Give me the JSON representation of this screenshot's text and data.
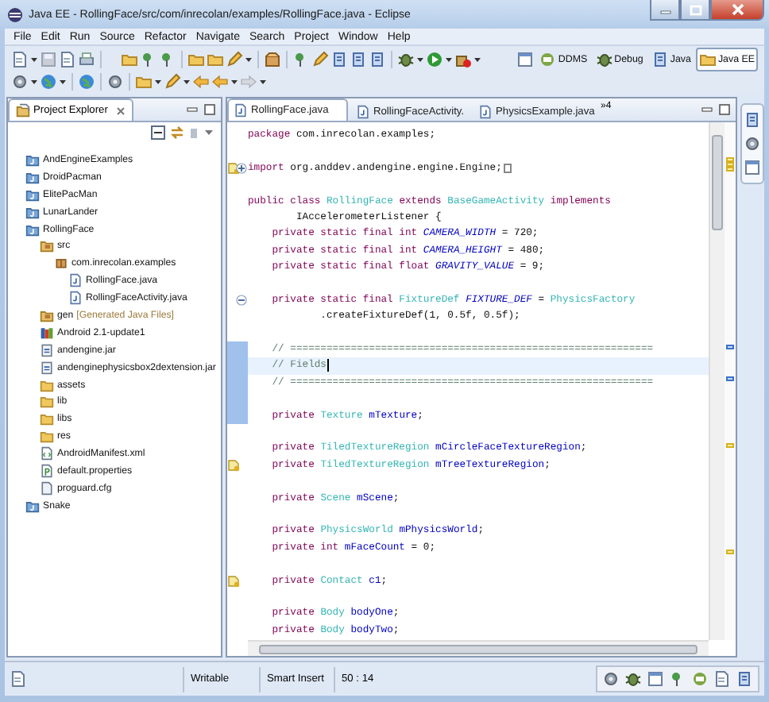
{
  "window": {
    "title": "Java EE - RollingFace/src/com/inrecolan/examples/RollingFace.java - Eclipse"
  },
  "menu": [
    "File",
    "Edit",
    "Run",
    "Source",
    "Refactor",
    "Navigate",
    "Search",
    "Project",
    "Window",
    "Help"
  ],
  "perspectives": [
    {
      "label": "DDMS",
      "kind": "ddms",
      "selected": false
    },
    {
      "label": "Debug",
      "kind": "debug",
      "selected": false
    },
    {
      "label": "Java",
      "kind": "java",
      "selected": false
    },
    {
      "label": "Java EE",
      "kind": "javaee",
      "selected": true
    }
  ],
  "explorer": {
    "title": "Project Explorer",
    "items": [
      {
        "label": "AndEngineExamples",
        "kind": "project"
      },
      {
        "label": "DroidPacman",
        "kind": "project"
      },
      {
        "label": "ElitePacMan",
        "kind": "project"
      },
      {
        "label": "LunarLander",
        "kind": "project"
      },
      {
        "label": "RollingFace",
        "kind": "project",
        "children": [
          {
            "label": "src",
            "kind": "source-folder",
            "children": [
              {
                "label": "com.inrecolan.examples",
                "kind": "package",
                "children": [
                  {
                    "label": "RollingFace.java",
                    "kind": "java"
                  },
                  {
                    "label": "RollingFaceActivity.java",
                    "kind": "java"
                  }
                ]
              }
            ]
          },
          {
            "label": "gen",
            "decoration": "[Generated Java Files]",
            "kind": "source-folder"
          },
          {
            "label": "Android 2.1-update1",
            "kind": "library"
          },
          {
            "label": "andengine.jar",
            "kind": "jar"
          },
          {
            "label": "andenginephysicsbox2dextension.jar",
            "kind": "jar"
          },
          {
            "label": "assets",
            "kind": "folder"
          },
          {
            "label": "lib",
            "kind": "folder"
          },
          {
            "label": "libs",
            "kind": "folder"
          },
          {
            "label": "res",
            "kind": "folder"
          },
          {
            "label": "AndroidManifest.xml",
            "kind": "xml"
          },
          {
            "label": "default.properties",
            "kind": "properties"
          },
          {
            "label": "proguard.cfg",
            "kind": "file"
          }
        ]
      },
      {
        "label": "Snake",
        "kind": "project"
      }
    ]
  },
  "editor": {
    "tabs": [
      {
        "label": "RollingFace.java",
        "selected": true
      },
      {
        "label": "RollingFaceActivity.",
        "selected": false
      },
      {
        "label": "PhysicsExample.java",
        "selected": false
      }
    ],
    "overflow": "»4",
    "lines": [
      {
        "kind": "code",
        "tokens": [
          {
            "kind": "keyword",
            "text": "package"
          },
          {
            "kind": "plain",
            "text": " com.inrecolan.examples;"
          }
        ]
      },
      {
        "kind": "blank"
      },
      {
        "kind": "code",
        "warning": true,
        "folded": true,
        "tokens": [
          {
            "kind": "keyword",
            "text": "import"
          },
          {
            "kind": "plain",
            "text": " org.anddev.andengine.engine.Engine;"
          }
        ]
      },
      {
        "kind": "blank"
      },
      {
        "kind": "code",
        "tokens": [
          {
            "kind": "keyword",
            "text": "public class "
          },
          {
            "kind": "type",
            "text": "RollingFace"
          },
          {
            "kind": "keyword",
            "text": " extends "
          },
          {
            "kind": "type",
            "text": "BaseGameActivity"
          },
          {
            "kind": "keyword",
            "text": " implements"
          }
        ]
      },
      {
        "kind": "code",
        "tokens": [
          {
            "kind": "plain",
            "text": "        IAccelerometerListener {"
          }
        ]
      },
      {
        "kind": "code",
        "tokens": [
          {
            "kind": "keyword",
            "text": "    private static final int "
          },
          {
            "kind": "constant",
            "text": "CAMERA_WIDTH"
          },
          {
            "kind": "plain",
            "text": " = 720;"
          }
        ]
      },
      {
        "kind": "code",
        "tokens": [
          {
            "kind": "keyword",
            "text": "    private static final int "
          },
          {
            "kind": "constant",
            "text": "CAMERA_HEIGHT"
          },
          {
            "kind": "plain",
            "text": " = 480;"
          }
        ]
      },
      {
        "kind": "code",
        "tokens": [
          {
            "kind": "keyword",
            "text": "    private static final float "
          },
          {
            "kind": "constant",
            "text": "GRAVITY_VALUE"
          },
          {
            "kind": "plain",
            "text": " = 9;"
          }
        ]
      },
      {
        "kind": "blank"
      },
      {
        "kind": "code",
        "folded": false,
        "tokens": [
          {
            "kind": "keyword",
            "text": "    private static final "
          },
          {
            "kind": "type",
            "text": "FixtureDef "
          },
          {
            "kind": "constant",
            "text": "FIXTURE_DEF"
          },
          {
            "kind": "plain",
            "text": " = "
          },
          {
            "kind": "type",
            "text": "PhysicsFactory"
          }
        ]
      },
      {
        "kind": "code",
        "tokens": [
          {
            "kind": "plain",
            "text": "            .createFixtureDef(1, 0.5f, 0.5f);"
          }
        ]
      },
      {
        "kind": "blank"
      },
      {
        "kind": "code",
        "range": true,
        "tokens": [
          {
            "kind": "comment",
            "text": "    // ============================================================"
          }
        ]
      },
      {
        "kind": "code",
        "range": true,
        "current": true,
        "tokens": [
          {
            "kind": "comment",
            "text": "    // Fields"
          }
        ]
      },
      {
        "kind": "code",
        "range": true,
        "tokens": [
          {
            "kind": "comment",
            "text": "    // ============================================================"
          }
        ]
      },
      {
        "kind": "blank",
        "range": true
      },
      {
        "kind": "code",
        "range": true,
        "tokens": [
          {
            "kind": "keyword",
            "text": "    private "
          },
          {
            "kind": "type",
            "text": "Texture "
          },
          {
            "kind": "field",
            "text": "mTexture"
          },
          {
            "kind": "plain",
            "text": ";"
          }
        ]
      },
      {
        "kind": "blank"
      },
      {
        "kind": "code",
        "tokens": [
          {
            "kind": "keyword",
            "text": "    private "
          },
          {
            "kind": "type",
            "text": "TiledTextureRegion "
          },
          {
            "kind": "field",
            "text": "mCircleFaceTextureRegion"
          },
          {
            "kind": "plain",
            "text": ";"
          }
        ]
      },
      {
        "kind": "code",
        "warning": true,
        "tokens": [
          {
            "kind": "keyword",
            "text": "    private "
          },
          {
            "kind": "type",
            "text": "TiledTextureRegion "
          },
          {
            "kind": "field",
            "text": "mTreeTextureRegion"
          },
          {
            "kind": "plain",
            "text": ";"
          }
        ]
      },
      {
        "kind": "blank"
      },
      {
        "kind": "code",
        "tokens": [
          {
            "kind": "keyword",
            "text": "    private "
          },
          {
            "kind": "type",
            "text": "Scene "
          },
          {
            "kind": "field",
            "text": "mScene"
          },
          {
            "kind": "plain",
            "text": ";"
          }
        ]
      },
      {
        "kind": "blank"
      },
      {
        "kind": "code",
        "tokens": [
          {
            "kind": "keyword",
            "text": "    private "
          },
          {
            "kind": "type",
            "text": "PhysicsWorld "
          },
          {
            "kind": "field",
            "text": "mPhysicsWorld"
          },
          {
            "kind": "plain",
            "text": ";"
          }
        ]
      },
      {
        "kind": "code",
        "tokens": [
          {
            "kind": "keyword",
            "text": "    private int "
          },
          {
            "kind": "field",
            "text": "mFaceCount"
          },
          {
            "kind": "plain",
            "text": " = 0;"
          }
        ]
      },
      {
        "kind": "blank"
      },
      {
        "kind": "code",
        "warning": true,
        "tokens": [
          {
            "kind": "keyword",
            "text": "    private "
          },
          {
            "kind": "type",
            "text": "Contact "
          },
          {
            "kind": "field",
            "text": "c1"
          },
          {
            "kind": "plain",
            "text": ";"
          }
        ]
      },
      {
        "kind": "blank"
      },
      {
        "kind": "code",
        "tokens": [
          {
            "kind": "keyword",
            "text": "    private "
          },
          {
            "kind": "type",
            "text": "Body "
          },
          {
            "kind": "field",
            "text": "bodyOne"
          },
          {
            "kind": "plain",
            "text": ";"
          }
        ]
      },
      {
        "kind": "code",
        "tokens": [
          {
            "kind": "keyword",
            "text": "    private "
          },
          {
            "kind": "type",
            "text": "Body "
          },
          {
            "kind": "field",
            "text": "bodyTwo"
          },
          {
            "kind": "plain",
            "text": ";"
          }
        ]
      }
    ]
  },
  "status_bar": {
    "mode": "Writable",
    "insert": "Smart Insert",
    "position": "50 : 14"
  }
}
